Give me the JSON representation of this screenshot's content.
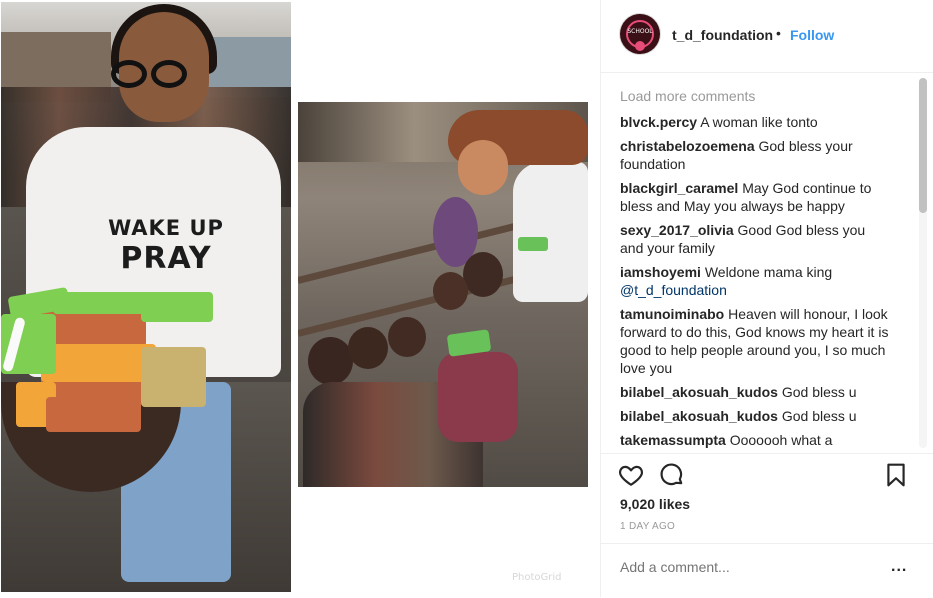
{
  "post": {
    "username": "t_d_foundation",
    "separator": "•",
    "follow_label": "Follow",
    "avatar_text": "SCHOOL",
    "load_more": "Load more comments",
    "comments": [
      {
        "user": "blvck.percy",
        "text": "A woman like tonto"
      },
      {
        "user": "christabelozoemena",
        "text": "God bless your foundation"
      },
      {
        "user": "blackgirl_caramel",
        "text": "May God continue to bless and May you always be happy"
      },
      {
        "user": "sexy_2017_olivia",
        "text": "Good God bless you and your family"
      },
      {
        "user": "iamshoyemi",
        "text": "Weldone mama king",
        "mention": "@t_d_foundation"
      },
      {
        "user": "tamunoiminabo",
        "text": "Heaven will honour, I look forward to do this, God knows my heart it is good to help people around you, I so much love you"
      },
      {
        "user": "bilabel_akosuah_kudos",
        "text": "God bless u"
      },
      {
        "user": "bilabel_akosuah_kudos",
        "text": "God bless u"
      },
      {
        "user": "takemassumpta",
        "text": "Ooooooh what a"
      }
    ],
    "likes": "9,020 likes",
    "time": "1 DAY AGO",
    "comment_placeholder": "Add a comment...",
    "more_label": "..."
  },
  "media": {
    "shirt_line1": "WAKE UP",
    "shirt_line2": "PRAY",
    "watermark": "PhotoGrid"
  },
  "icons": {
    "like": "heart-icon",
    "comment": "comment-bubble-icon",
    "save": "bookmark-icon"
  },
  "colors": {
    "follow": "#3897f0",
    "text": "#262626",
    "muted": "#999999",
    "mention": "#003569"
  }
}
